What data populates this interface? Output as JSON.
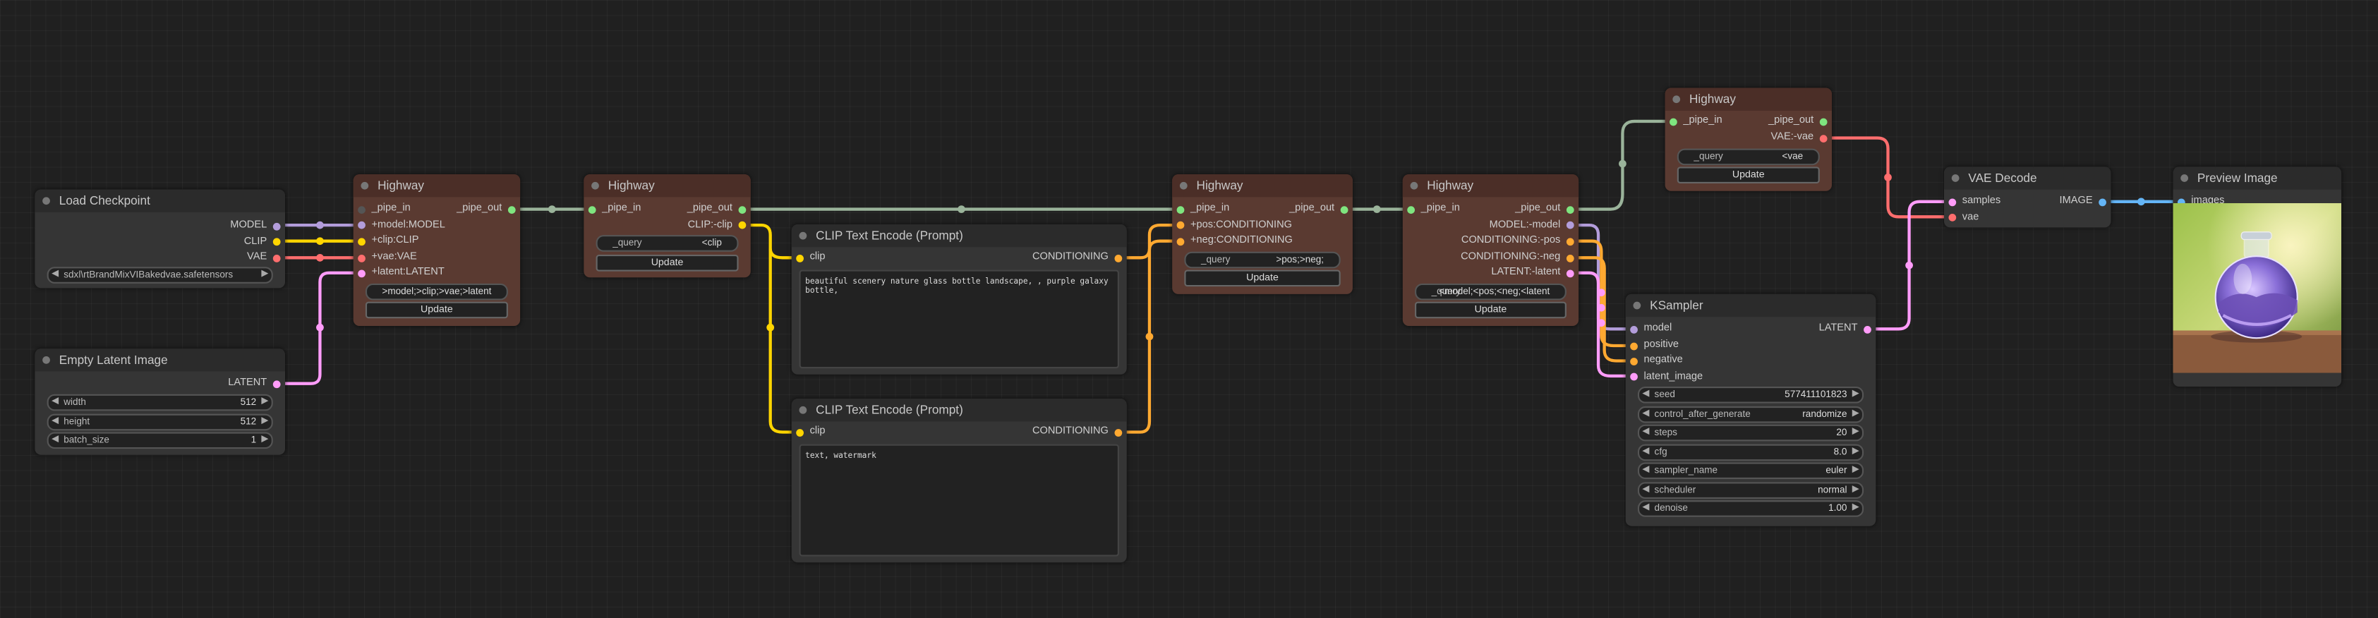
{
  "colors": {
    "model": "#b39ddb",
    "clip": "#ffd500",
    "vae": "#ff6e6e",
    "latent": "#ff9cf9",
    "conditioning": "#ffa931",
    "image": "#64b5f6",
    "pipe": "#9ab39a",
    "canvas": "#202020"
  },
  "load_checkpoint": {
    "title": "Load Checkpoint",
    "out_model": "MODEL",
    "out_clip": "CLIP",
    "out_vae": "VAE",
    "ckpt_name": "sdxl\\rtBrandMixVIBakedvae.safetensors"
  },
  "empty_latent": {
    "title": "Empty Latent Image",
    "out_latent": "LATENT",
    "width_label": "width",
    "width_value": "512",
    "height_label": "height",
    "height_value": "512",
    "batch_label": "batch_size",
    "batch_value": "1"
  },
  "highway1": {
    "title": "Highway",
    "in_pipe": "_pipe_in",
    "in_model": "+model:MODEL",
    "in_clip": "+clip:CLIP",
    "in_vae": "+vae:VAE",
    "in_latent": "+latent:LATENT",
    "out_pipe": "_pipe_out",
    "query": ">model;>clip;>vae;>latent",
    "update": "Update"
  },
  "highway2": {
    "title": "Highway",
    "in_pipe": "_pipe_in",
    "out_pipe": "_pipe_out",
    "out_clip": "CLIP:-clip",
    "query_label": "_query",
    "query_value": "<clip",
    "update": "Update"
  },
  "clip_pos": {
    "title": "CLIP Text Encode (Prompt)",
    "in_clip": "clip",
    "out_cond": "CONDITIONING",
    "text": "beautiful scenery nature glass bottle landscape, , purple galaxy bottle,"
  },
  "clip_neg": {
    "title": "CLIP Text Encode (Prompt)",
    "in_clip": "clip",
    "out_cond": "CONDITIONING",
    "text": "text, watermark"
  },
  "highway3": {
    "title": "Highway",
    "in_pipe": "_pipe_in",
    "in_pos": "+pos:CONDITIONING",
    "in_neg": "+neg:CONDITIONING",
    "out_pipe": "_pipe_out",
    "query_label": "_query",
    "query_value": ">pos;>neg;",
    "update": "Update"
  },
  "highway4": {
    "title": "Highway",
    "in_pipe": "_pipe_in",
    "out_pipe": "_pipe_out",
    "out_model": "MODEL:-model",
    "out_pos": "CONDITIONING:-pos",
    "out_neg": "CONDITIONING:-neg",
    "out_latent": "LATENT:-latent",
    "query_label": "_query",
    "query_value": "<model;<pos;<neg;<latent",
    "update": "Update"
  },
  "highway5": {
    "title": "Highway",
    "in_pipe": "_pipe_in",
    "out_pipe": "_pipe_out",
    "out_vae": "VAE:-vae",
    "query_label": "_query",
    "query_value": "<vae",
    "update": "Update"
  },
  "ksampler": {
    "title": "KSampler",
    "in_model": "model",
    "in_positive": "positive",
    "in_negative": "negative",
    "in_latent": "latent_image",
    "out_latent": "LATENT",
    "widgets": [
      {
        "label": "seed",
        "value": "577411101823"
      },
      {
        "label": "control_after_generate",
        "value": "randomize"
      },
      {
        "label": "steps",
        "value": "20"
      },
      {
        "label": "cfg",
        "value": "8.0"
      },
      {
        "label": "sampler_name",
        "value": "euler"
      },
      {
        "label": "scheduler",
        "value": "normal"
      },
      {
        "label": "denoise",
        "value": "1.00"
      }
    ]
  },
  "vae_decode": {
    "title": "VAE Decode",
    "in_samples": "samples",
    "in_vae": "vae",
    "out_image": "IMAGE"
  },
  "preview": {
    "title": "Preview Image",
    "in_images": "images"
  },
  "icons": {
    "arrow_left": "◀",
    "arrow_right": "▶"
  }
}
